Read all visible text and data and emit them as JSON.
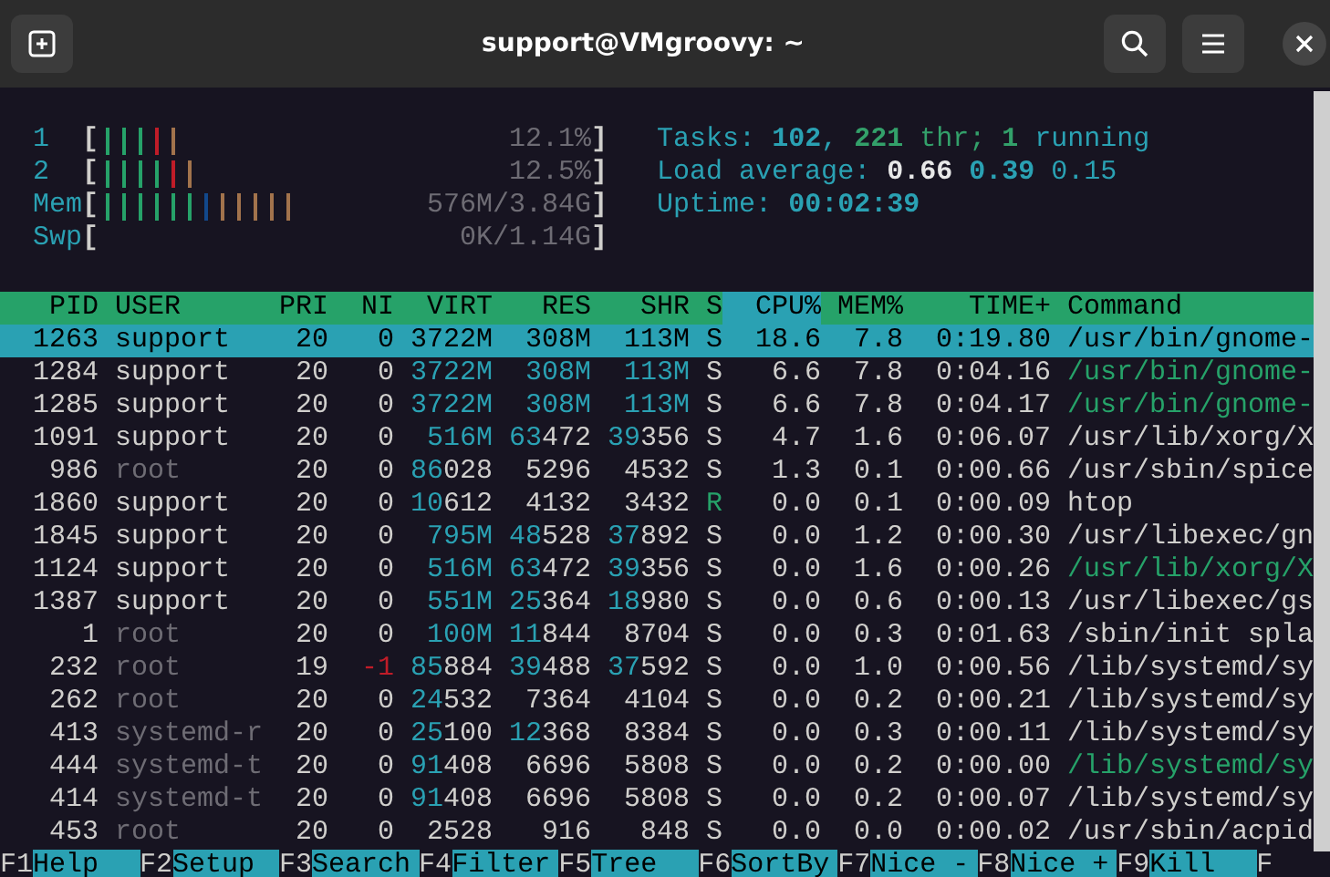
{
  "window": {
    "title": "support@VMgroovy: ~"
  },
  "meters": [
    {
      "label": "1",
      "open": "[",
      "close": "]",
      "reading": "12.1%",
      "bars": [
        {
          "color": "#26a269"
        },
        {
          "color": "#26a269"
        },
        {
          "color": "#26a269"
        },
        {
          "color": "#c01c28"
        },
        {
          "color": "#a2734c"
        }
      ]
    },
    {
      "label": "2",
      "open": "[",
      "close": "]",
      "reading": "12.5%",
      "bars": [
        {
          "color": "#26a269"
        },
        {
          "color": "#26a269"
        },
        {
          "color": "#26a269"
        },
        {
          "color": "#26a269"
        },
        {
          "color": "#c01c28"
        },
        {
          "color": "#a2734c"
        }
      ]
    },
    {
      "label": "Mem",
      "open": "[",
      "close": "]",
      "reading": "576M/3.84G",
      "bars": [
        {
          "color": "#26a269"
        },
        {
          "color": "#26a269"
        },
        {
          "color": "#26a269"
        },
        {
          "color": "#26a269"
        },
        {
          "color": "#26a269"
        },
        {
          "color": "#26a269"
        },
        {
          "color": "#12488b"
        },
        {
          "color": "#a2734c"
        },
        {
          "color": "#a2734c"
        },
        {
          "color": "#a2734c"
        },
        {
          "color": "#a2734c"
        },
        {
          "color": "#a2734c"
        }
      ]
    },
    {
      "label": "Swp",
      "open": "[",
      "close": "]",
      "reading": "0K/1.14G"
    }
  ],
  "summary": [
    [
      {
        "text": "Tasks: ",
        "kind": "label"
      },
      {
        "text": "102",
        "kind": "value"
      },
      {
        "text": ", ",
        "kind": "label"
      },
      {
        "text": "221",
        "kind": "thread_value"
      },
      {
        "text": " thr; ",
        "kind": "thread_label"
      },
      {
        "text": "1",
        "kind": "thread_value"
      },
      {
        "text": " running",
        "kind": "label"
      }
    ],
    [
      {
        "text": "Load average: ",
        "kind": "label"
      },
      {
        "text": "0.66",
        "kind": "load_high"
      },
      {
        "text": " 0.39",
        "kind": "value"
      },
      {
        "text": " 0.15",
        "kind": "label"
      }
    ],
    [
      {
        "text": "Uptime: ",
        "kind": "label"
      },
      {
        "text": "00:02:39",
        "kind": "value"
      }
    ]
  ],
  "table": {
    "columns": [
      {
        "label": "PID",
        "sorted": false
      },
      {
        "label": "USER",
        "sorted": false
      },
      {
        "label": "PRI",
        "sorted": false
      },
      {
        "label": "NI",
        "sorted": false
      },
      {
        "label": "VIRT",
        "sorted": false
      },
      {
        "label": "RES",
        "sorted": false
      },
      {
        "label": "SHR",
        "sorted": false
      },
      {
        "label": "S",
        "sorted": false
      },
      {
        "label": "CPU%",
        "sorted": true
      },
      {
        "label": "MEM%",
        "sorted": false
      },
      {
        "label": "TIME+",
        "sorted": false
      },
      {
        "label": "Command",
        "sorted": false
      }
    ],
    "rows": [
      {
        "selected": true,
        "own": true,
        "thread": false,
        "running": false,
        "cells": [
          "1263",
          "support",
          "20",
          "0",
          "3722M",
          "308M",
          "113M",
          "S",
          "18.6",
          "7.8",
          "0:19.80",
          "/usr/bin/gnome-"
        ]
      },
      {
        "selected": false,
        "own": true,
        "thread": true,
        "running": false,
        "cells": [
          "1284",
          "support",
          "20",
          "0",
          "3722M",
          "308M",
          "113M",
          "S",
          "6.6",
          "7.8",
          "0:04.16",
          "/usr/bin/gnome-"
        ]
      },
      {
        "selected": false,
        "own": true,
        "thread": true,
        "running": false,
        "cells": [
          "1285",
          "support",
          "20",
          "0",
          "3722M",
          "308M",
          "113M",
          "S",
          "6.6",
          "7.8",
          "0:04.17",
          "/usr/bin/gnome-"
        ]
      },
      {
        "selected": false,
        "own": true,
        "thread": false,
        "running": false,
        "cells": [
          "1091",
          "support",
          "20",
          "0",
          "516M",
          "63472",
          "39356",
          "S",
          "4.7",
          "1.6",
          "0:06.07",
          "/usr/lib/xorg/X"
        ]
      },
      {
        "selected": false,
        "own": false,
        "thread": false,
        "running": false,
        "cells": [
          "986",
          "root",
          "20",
          "0",
          "86028",
          "5296",
          "4532",
          "S",
          "1.3",
          "0.1",
          "0:00.66",
          "/usr/sbin/spice"
        ]
      },
      {
        "selected": false,
        "own": true,
        "thread": false,
        "running": true,
        "cells": [
          "1860",
          "support",
          "20",
          "0",
          "10612",
          "4132",
          "3432",
          "R",
          "0.0",
          "0.1",
          "0:00.09",
          "htop"
        ]
      },
      {
        "selected": false,
        "own": true,
        "thread": false,
        "running": false,
        "cells": [
          "1845",
          "support",
          "20",
          "0",
          "795M",
          "48528",
          "37892",
          "S",
          "0.0",
          "1.2",
          "0:00.30",
          "/usr/libexec/gn"
        ]
      },
      {
        "selected": false,
        "own": true,
        "thread": true,
        "running": false,
        "cells": [
          "1124",
          "support",
          "20",
          "0",
          "516M",
          "63472",
          "39356",
          "S",
          "0.0",
          "1.6",
          "0:00.26",
          "/usr/lib/xorg/X"
        ]
      },
      {
        "selected": false,
        "own": true,
        "thread": false,
        "running": false,
        "cells": [
          "1387",
          "support",
          "20",
          "0",
          "551M",
          "25364",
          "18980",
          "S",
          "0.0",
          "0.6",
          "0:00.13",
          "/usr/libexec/gs"
        ]
      },
      {
        "selected": false,
        "own": false,
        "thread": false,
        "running": false,
        "cells": [
          "1",
          "root",
          "20",
          "0",
          "100M",
          "11844",
          "8704",
          "S",
          "0.0",
          "0.3",
          "0:01.63",
          "/sbin/init spla"
        ]
      },
      {
        "selected": false,
        "own": false,
        "thread": false,
        "running": false,
        "cells": [
          "232",
          "root",
          "19",
          "-1",
          "85884",
          "39488",
          "37592",
          "S",
          "0.0",
          "1.0",
          "0:00.56",
          "/lib/systemd/sy"
        ]
      },
      {
        "selected": false,
        "own": false,
        "thread": false,
        "running": false,
        "cells": [
          "262",
          "root",
          "20",
          "0",
          "24532",
          "7364",
          "4104",
          "S",
          "0.0",
          "0.2",
          "0:00.21",
          "/lib/systemd/sy"
        ]
      },
      {
        "selected": false,
        "own": false,
        "thread": false,
        "running": false,
        "cells": [
          "413",
          "systemd-r",
          "20",
          "0",
          "25100",
          "12368",
          "8384",
          "S",
          "0.0",
          "0.3",
          "0:00.11",
          "/lib/systemd/sy"
        ]
      },
      {
        "selected": false,
        "own": false,
        "thread": true,
        "running": false,
        "cells": [
          "444",
          "systemd-t",
          "20",
          "0",
          "91408",
          "6696",
          "5808",
          "S",
          "0.0",
          "0.2",
          "0:00.00",
          "/lib/systemd/sy"
        ]
      },
      {
        "selected": false,
        "own": false,
        "thread": false,
        "running": false,
        "cells": [
          "414",
          "systemd-t",
          "20",
          "0",
          "91408",
          "6696",
          "5808",
          "S",
          "0.0",
          "0.2",
          "0:00.07",
          "/lib/systemd/sy"
        ]
      },
      {
        "selected": false,
        "own": false,
        "thread": false,
        "running": false,
        "cells": [
          "453",
          "root",
          "20",
          "0",
          "2528",
          "916",
          "848",
          "S",
          "0.0",
          "0.0",
          "0:00.02",
          "/usr/sbin/acpid"
        ]
      }
    ]
  },
  "function_keys": [
    {
      "key": "F1",
      "label": "Help"
    },
    {
      "key": "F2",
      "label": "Setup"
    },
    {
      "key": "F3",
      "label": "Search"
    },
    {
      "key": "F4",
      "label": "Filter"
    },
    {
      "key": "F5",
      "label": "Tree"
    },
    {
      "key": "F6",
      "label": "SortBy"
    },
    {
      "key": "F7",
      "label": "Nice -"
    },
    {
      "key": "F8",
      "label": "Nice +"
    },
    {
      "key": "F9",
      "label": "Kill"
    },
    {
      "key": "F"
    }
  ]
}
